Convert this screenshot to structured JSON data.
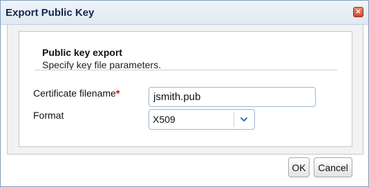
{
  "window": {
    "title": "Export Public Key",
    "close_symbol": "×"
  },
  "section": {
    "title": "Public key export",
    "subtitle": "Specify key file parameters."
  },
  "fields": {
    "certificate_filename": {
      "label": "Certificate filename",
      "required_mark": "*",
      "value": "jsmith.pub"
    },
    "format": {
      "label": "Format",
      "selected": "X509"
    }
  },
  "buttons": {
    "ok": "OK",
    "cancel": "Cancel"
  },
  "icons": {
    "close": "close-icon",
    "dropdown": "chevron-down-icon"
  },
  "colors": {
    "title_text": "#14284a",
    "close_button": "#c9472d",
    "required_mark": "#d40000",
    "input_border": "#9fb5d2",
    "dropdown_chevron": "#3d6fb0"
  }
}
